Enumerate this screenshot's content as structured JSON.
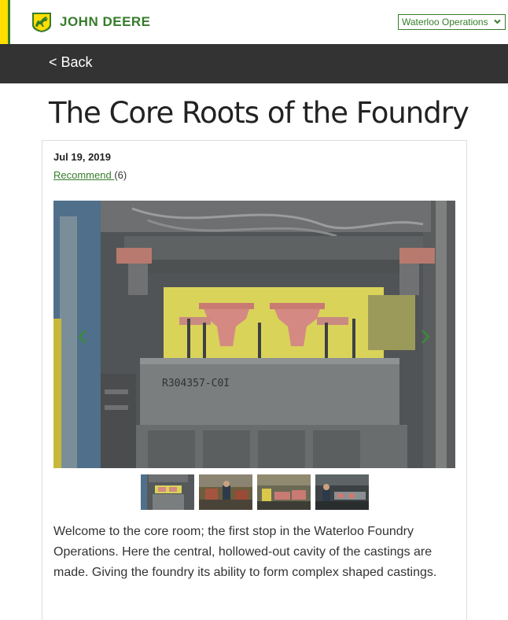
{
  "header": {
    "brand": "JOHN DEERE",
    "location_select": "Waterloo Operations",
    "logo_icon": "john-deere-deer-logo"
  },
  "nav": {
    "back_label": "< Back"
  },
  "article": {
    "title": "The Core Roots of the Foundry",
    "date": "Jul 19, 2019",
    "recommend_label": "Recommend ",
    "recommend_count": "(6)",
    "image_text": "R304357-C0I",
    "body": "Welcome to the core room; the first stop in the Waterloo Foundry Operations.  Here the central, hollowed-out cavity of the castings are made. Giving the foundry its ability to form complex shaped castings."
  },
  "colors": {
    "brand_green": "#367c2b",
    "brand_yellow": "#ffde00",
    "nav_bg": "#333333"
  }
}
